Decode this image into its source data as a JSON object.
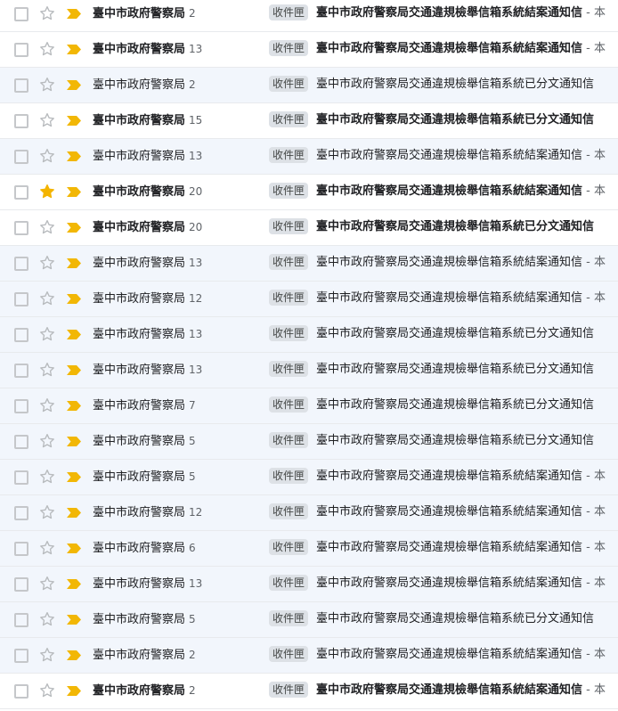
{
  "colors": {
    "star_active": "#f4b400",
    "importance": "#f2b705",
    "read_row_bg": "#f2f6fc",
    "unread_row_bg": "#ffffff"
  },
  "icons": {
    "checkbox": "checkbox-icon",
    "star": "star-icon",
    "importance": "importance-marker-icon"
  },
  "emails": [
    {
      "sender": "臺中市政府警察局",
      "count": "2",
      "label": "收件匣",
      "subject": "臺中市政府警察局交通違規檢舉信箱系統結案通知信",
      "snippet": " - 本",
      "unread": true,
      "starred": false
    },
    {
      "sender": "臺中市政府警察局",
      "count": "13",
      "label": "收件匣",
      "subject": "臺中市政府警察局交通違規檢舉信箱系統結案通知信",
      "snippet": " - 本",
      "unread": true,
      "starred": false
    },
    {
      "sender": "臺中市政府警察局",
      "count": "2",
      "label": "收件匣",
      "subject": "臺中市政府警察局交通違規檢舉信箱系統已分文通知信",
      "snippet": "",
      "unread": false,
      "starred": false
    },
    {
      "sender": "臺中市政府警察局",
      "count": "15",
      "label": "收件匣",
      "subject": "臺中市政府警察局交通違規檢舉信箱系統已分文通知信",
      "snippet": "",
      "unread": true,
      "starred": false
    },
    {
      "sender": "臺中市政府警察局",
      "count": "13",
      "label": "收件匣",
      "subject": "臺中市政府警察局交通違規檢舉信箱系統結案通知信",
      "snippet": " - 本",
      "unread": false,
      "starred": false
    },
    {
      "sender": "臺中市政府警察局",
      "count": "20",
      "label": "收件匣",
      "subject": "臺中市政府警察局交通違規檢舉信箱系統結案通知信",
      "snippet": " - 本",
      "unread": true,
      "starred": true
    },
    {
      "sender": "臺中市政府警察局",
      "count": "20",
      "label": "收件匣",
      "subject": "臺中市政府警察局交通違規檢舉信箱系統已分文通知信",
      "snippet": "",
      "unread": true,
      "starred": false
    },
    {
      "sender": "臺中市政府警察局",
      "count": "13",
      "label": "收件匣",
      "subject": "臺中市政府警察局交通違規檢舉信箱系統結案通知信",
      "snippet": " - 本",
      "unread": false,
      "starred": false
    },
    {
      "sender": "臺中市政府警察局",
      "count": "12",
      "label": "收件匣",
      "subject": "臺中市政府警察局交通違規檢舉信箱系統結案通知信",
      "snippet": " - 本",
      "unread": false,
      "starred": false
    },
    {
      "sender": "臺中市政府警察局",
      "count": "13",
      "label": "收件匣",
      "subject": "臺中市政府警察局交通違規檢舉信箱系統已分文通知信",
      "snippet": "",
      "unread": false,
      "starred": false
    },
    {
      "sender": "臺中市政府警察局",
      "count": "13",
      "label": "收件匣",
      "subject": "臺中市政府警察局交通違規檢舉信箱系統已分文通知信",
      "snippet": "",
      "unread": false,
      "starred": false
    },
    {
      "sender": "臺中市政府警察局",
      "count": "7",
      "label": "收件匣",
      "subject": "臺中市政府警察局交通違規檢舉信箱系統已分文通知信",
      "snippet": "",
      "unread": false,
      "starred": false
    },
    {
      "sender": "臺中市政府警察局",
      "count": "5",
      "label": "收件匣",
      "subject": "臺中市政府警察局交通違規檢舉信箱系統已分文通知信",
      "snippet": "",
      "unread": false,
      "starred": false
    },
    {
      "sender": "臺中市政府警察局",
      "count": "5",
      "label": "收件匣",
      "subject": "臺中市政府警察局交通違規檢舉信箱系統結案通知信",
      "snippet": " - 本",
      "unread": false,
      "starred": false
    },
    {
      "sender": "臺中市政府警察局",
      "count": "12",
      "label": "收件匣",
      "subject": "臺中市政府警察局交通違規檢舉信箱系統結案通知信",
      "snippet": " - 本",
      "unread": false,
      "starred": false
    },
    {
      "sender": "臺中市政府警察局",
      "count": "6",
      "label": "收件匣",
      "subject": "臺中市政府警察局交通違規檢舉信箱系統結案通知信",
      "snippet": " - 本",
      "unread": false,
      "starred": false
    },
    {
      "sender": "臺中市政府警察局",
      "count": "13",
      "label": "收件匣",
      "subject": "臺中市政府警察局交通違規檢舉信箱系統結案通知信",
      "snippet": " - 本",
      "unread": false,
      "starred": false
    },
    {
      "sender": "臺中市政府警察局",
      "count": "5",
      "label": "收件匣",
      "subject": "臺中市政府警察局交通違規檢舉信箱系統已分文通知信",
      "snippet": "",
      "unread": false,
      "starred": false
    },
    {
      "sender": "臺中市政府警察局",
      "count": "2",
      "label": "收件匣",
      "subject": "臺中市政府警察局交通違規檢舉信箱系統結案通知信",
      "snippet": " - 本",
      "unread": false,
      "starred": false
    },
    {
      "sender": "臺中市政府警察局",
      "count": "2",
      "label": "收件匣",
      "subject": "臺中市政府警察局交通違規檢舉信箱系統結案通知信",
      "snippet": " - 本",
      "unread": true,
      "starred": false
    }
  ]
}
